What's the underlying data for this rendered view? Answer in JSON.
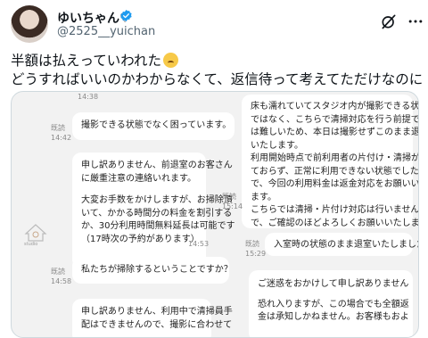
{
  "author": {
    "name": "ゆいちゃん♡",
    "handle": "@2525__yuichan"
  },
  "tweet": {
    "line1": "半額は払えっていわれた",
    "line2": "どうすればいいのかわからなくて、返信待って考えてただけなのに",
    "emoji": "crying-face-emoji"
  },
  "chat": {
    "top_time_cut": "14:38",
    "left_messages": [
      {
        "status": "既読",
        "time": "14:42",
        "lines": [
          "撮影できる状態でなく困っています。"
        ]
      },
      {
        "status": "",
        "time": "14:53",
        "lines": [
          "申し訳ありません、前退室のお客さん",
          "に厳重注意の連絡いれます。",
          "",
          "大変お手数をかけしますが、お掃除頂",
          "いて、かかる時間分の料金を割引する",
          "か、30分利用時間無料延長は可能です",
          "（17時次の予約があります）"
        ]
      },
      {
        "status": "既読",
        "time": "14:58",
        "lines": [
          "私たちが掃除するということですか？"
        ]
      },
      {
        "status": "",
        "time": "",
        "lines": [
          "申し訳ありません、利用中で清掃員手",
          "配はできませんので、撮影に合わせて"
        ]
      }
    ],
    "right_messages": [
      {
        "status": "既読",
        "time": "15:14",
        "lines": [
          "床も濡れていてスタジオ内が撮影できる状態",
          "ではなく、こちらで清掃対応を行う前提での利用",
          "は難しいため、本日は撮影せずこのまま退出",
          "いたします。",
          "利用開始時点で前利用者の片付け・清掃がされ",
          "ておらず、正常に利用できない状態でしたの",
          "で、今回の利用料金は返金対応をお願いいたし",
          "ます。",
          "こちらでは清掃・片付け対応は行いませんの",
          "で、ご確認のほどよろしくお願いいたします。"
        ]
      },
      {
        "status": "既読",
        "time": "15:29",
        "lines": [
          "入室時の状態のまま退室いたしました。"
        ]
      },
      {
        "status": "",
        "time": "",
        "lines": [
          "ご迷惑をおかけして申し訳ありません",
          "",
          "恐れ入りますが、この場合でも全額返",
          "金は承知しかねません。お客様もおよ"
        ]
      }
    ]
  }
}
